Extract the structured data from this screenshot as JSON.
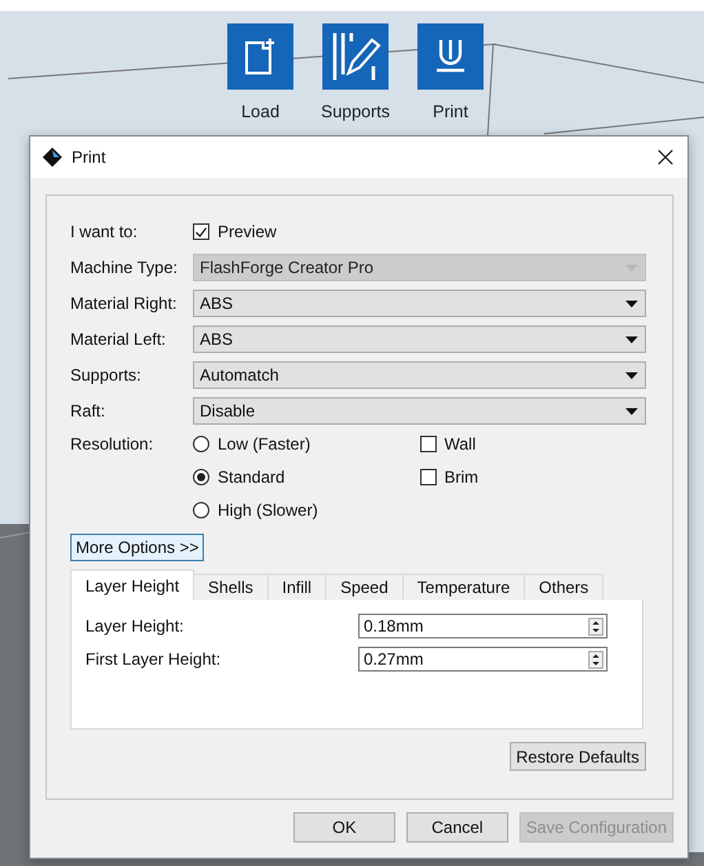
{
  "toolbar": [
    {
      "kind": "load",
      "label": "Load"
    },
    {
      "kind": "supports",
      "label": "Supports"
    },
    {
      "kind": "print",
      "label": "Print"
    }
  ],
  "dialog": {
    "title": "Print"
  },
  "intent": {
    "label": "I want to:",
    "option": "Preview",
    "checked": true
  },
  "selects": [
    {
      "label": "Machine Type:",
      "value": "FlashForge Creator Pro",
      "disabled": true
    },
    {
      "label": "Material Right:",
      "value": "ABS",
      "disabled": false
    },
    {
      "label": "Material Left:",
      "value": "ABS",
      "disabled": false
    },
    {
      "label": "Supports:",
      "value": "Automatch",
      "disabled": false
    },
    {
      "label": "Raft:",
      "value": "Disable",
      "disabled": false
    }
  ],
  "resolution": {
    "label": "Resolution:",
    "options": [
      {
        "label": "Low (Faster)",
        "selected": false
      },
      {
        "label": "Standard",
        "selected": true
      },
      {
        "label": "High (Slower)",
        "selected": false
      }
    ]
  },
  "extras": [
    {
      "label": "Wall",
      "checked": false
    },
    {
      "label": "Brim",
      "checked": false
    }
  ],
  "more_options": "More Options >>",
  "tabs": [
    {
      "label": "Layer Height",
      "selected": true
    },
    {
      "label": "Shells",
      "selected": false
    },
    {
      "label": "Infill",
      "selected": false
    },
    {
      "label": "Speed",
      "selected": false
    },
    {
      "label": "Temperature",
      "selected": false
    },
    {
      "label": "Others",
      "selected": false
    }
  ],
  "fields": [
    {
      "label": "Layer Height:",
      "value": "0.18mm"
    },
    {
      "label": "First Layer Height:",
      "value": "0.27mm"
    }
  ],
  "restore": "Restore Defaults",
  "buttons": [
    {
      "label": "OK",
      "disabled": false
    },
    {
      "label": "Cancel",
      "disabled": false
    },
    {
      "label": "Save Configuration",
      "disabled": true
    }
  ]
}
